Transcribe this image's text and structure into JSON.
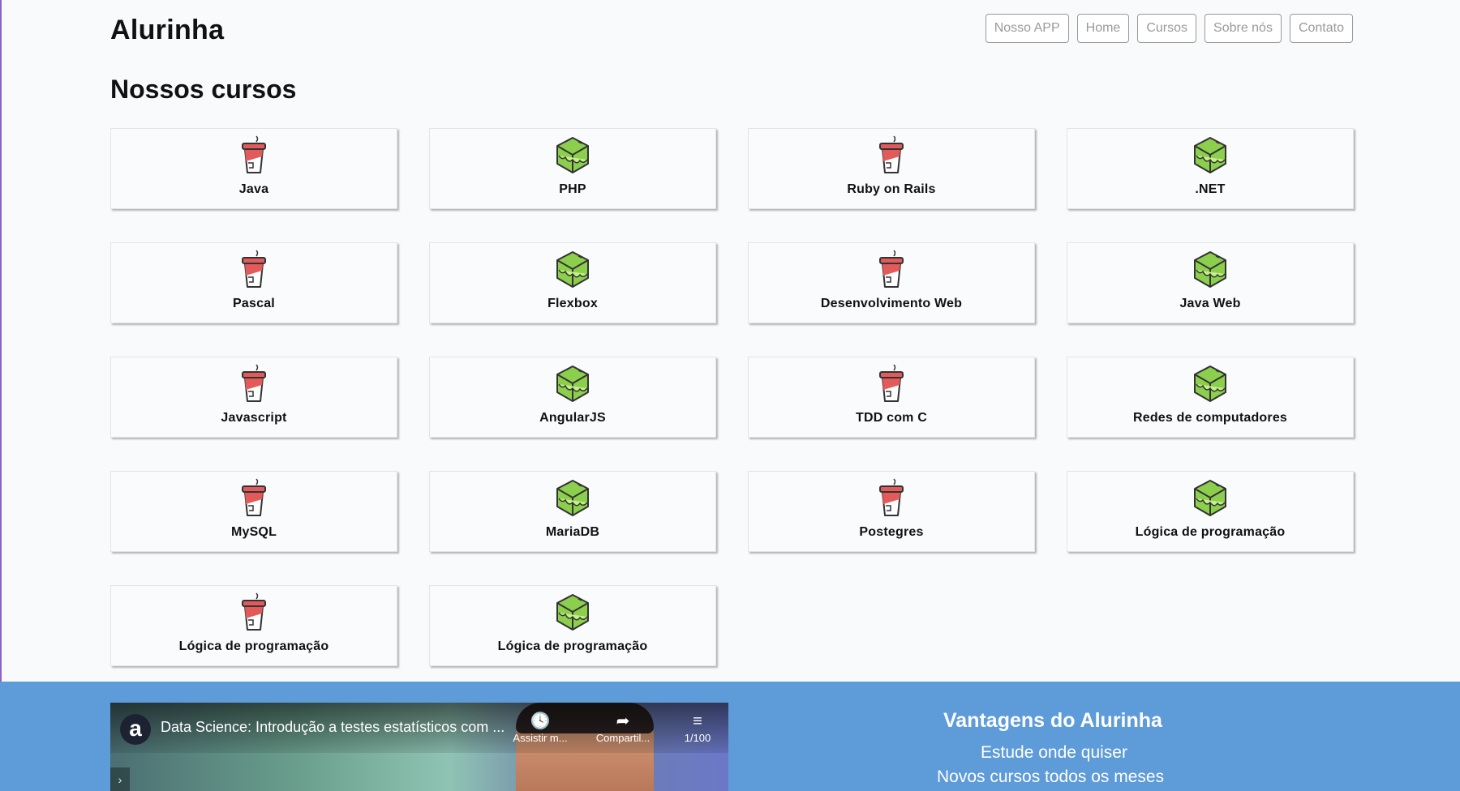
{
  "header": {
    "brand": "Alurinha",
    "nav": [
      "Nosso APP",
      "Home",
      "Cursos",
      "Sobre nós",
      "Contato"
    ]
  },
  "section_title": "Nossos cursos",
  "colors": {
    "page_bg": "#f9fafc",
    "band_bg": "#5e9bd9",
    "cup_red": "#e35a5a",
    "cube_green": "#8ccf4d"
  },
  "courses": [
    {
      "label": "Java",
      "icon": "cup-icon"
    },
    {
      "label": "PHP",
      "icon": "cube-icon"
    },
    {
      "label": "Ruby on Rails",
      "icon": "cup-icon"
    },
    {
      "label": ".NET",
      "icon": "cube-icon"
    },
    {
      "label": "Pascal",
      "icon": "cup-icon"
    },
    {
      "label": "Flexbox",
      "icon": "cube-icon"
    },
    {
      "label": "Desenvolvimento Web",
      "icon": "cup-icon"
    },
    {
      "label": "Java Web",
      "icon": "cube-icon"
    },
    {
      "label": "Javascript",
      "icon": "cup-icon"
    },
    {
      "label": "AngularJS",
      "icon": "cube-icon"
    },
    {
      "label": "TDD com C",
      "icon": "cup-icon"
    },
    {
      "label": "Redes de computadores",
      "icon": "cube-icon"
    },
    {
      "label": "MySQL",
      "icon": "cup-icon"
    },
    {
      "label": "MariaDB",
      "icon": "cube-icon"
    },
    {
      "label": "Postegres",
      "icon": "cup-icon"
    },
    {
      "label": "Lógica de programação",
      "icon": "cube-icon"
    },
    {
      "label": "Lógica de programação",
      "icon": "cup-icon"
    },
    {
      "label": "Lógica de programação",
      "icon": "cube-icon"
    }
  ],
  "video": {
    "logo": "a",
    "title": "Data Science: Introdução a testes estatísticos com ...",
    "watch_later": "Assistir m...",
    "share": "Compartil...",
    "playlist": "1/100"
  },
  "advantages": {
    "title": "Vantagens do Alurinha",
    "items": [
      "Estude onde quiser",
      "Novos cursos todos os meses"
    ]
  }
}
